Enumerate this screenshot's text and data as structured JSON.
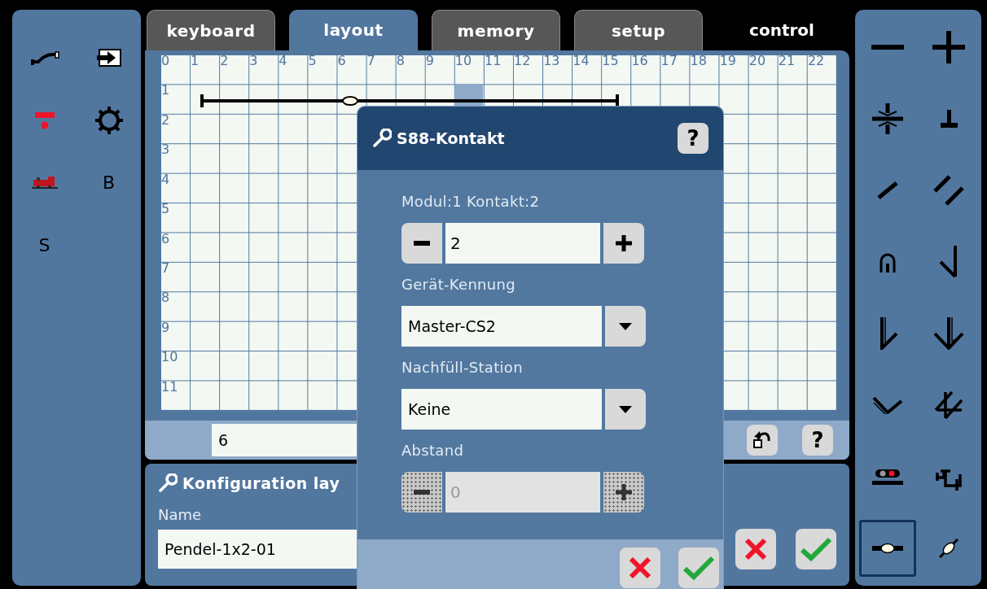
{
  "left_toolbar": {
    "items": [
      {
        "kind": "track"
      },
      {
        "kind": "exit"
      },
      {
        "kind": "signal"
      },
      {
        "kind": "gear"
      },
      {
        "kind": "locomotive"
      },
      {
        "kind": "letter",
        "label": "B"
      },
      {
        "kind": "letter",
        "label": "S"
      }
    ]
  },
  "tabs": [
    {
      "label": "keyboard",
      "selected": false,
      "kind": "tab"
    },
    {
      "label": "layout",
      "selected": true,
      "kind": "tab"
    },
    {
      "label": "memory",
      "selected": false,
      "kind": "tab"
    },
    {
      "label": "setup",
      "selected": false,
      "kind": "tab"
    },
    {
      "label": "control",
      "selected": false,
      "kind": "plain"
    }
  ],
  "grid": {
    "columns": [
      "0",
      "1",
      "2",
      "3",
      "4",
      "5",
      "6",
      "7",
      "8",
      "9",
      "10",
      "11",
      "12",
      "13",
      "14",
      "15",
      "16",
      "17",
      "18",
      "19",
      "20",
      "21",
      "22"
    ],
    "rows": [
      "1",
      "2",
      "3",
      "4",
      "5",
      "6",
      "7",
      "8",
      "9",
      "10",
      "11"
    ]
  },
  "bottom_bar": {
    "field_value": "6",
    "help_label": "?"
  },
  "config": {
    "title": "Konfiguration lay",
    "name_label": "Name",
    "name_value": "Pendel-1x2-01"
  },
  "dialog": {
    "title": "S88-Kontakt",
    "help_label": "?",
    "fields": [
      {
        "kind": "spinner",
        "label": "Modul:1 Kontakt:2",
        "value": "2",
        "disabled": false
      },
      {
        "kind": "dropdown",
        "label": "Gerät-Kennung",
        "value": "Master-CS2"
      },
      {
        "kind": "dropdown",
        "label": "Nachfüll-Station",
        "value": "Keine"
      },
      {
        "kind": "spinner",
        "label": "Abstand",
        "value": "0",
        "disabled": true
      }
    ]
  },
  "right_toolbar": {
    "items": [
      {
        "kind": "minus",
        "selected": false
      },
      {
        "kind": "plus",
        "selected": false
      },
      {
        "kind": "isolator",
        "selected": false
      },
      {
        "kind": "bumper",
        "selected": false
      },
      {
        "kind": "diagonal",
        "selected": false
      },
      {
        "kind": "double-diagonal",
        "selected": false
      },
      {
        "kind": "tunnel",
        "selected": false
      },
      {
        "kind": "turnout",
        "selected": false
      },
      {
        "kind": "turnout-wye",
        "selected": false
      },
      {
        "kind": "three-way",
        "selected": false
      },
      {
        "kind": "curve",
        "selected": false
      },
      {
        "kind": "double-slip",
        "selected": false
      },
      {
        "kind": "signal-track",
        "selected": false
      },
      {
        "kind": "decoupler",
        "selected": false
      },
      {
        "kind": "contact",
        "selected": true
      },
      {
        "kind": "contact-diagonal",
        "selected": false
      }
    ]
  }
}
